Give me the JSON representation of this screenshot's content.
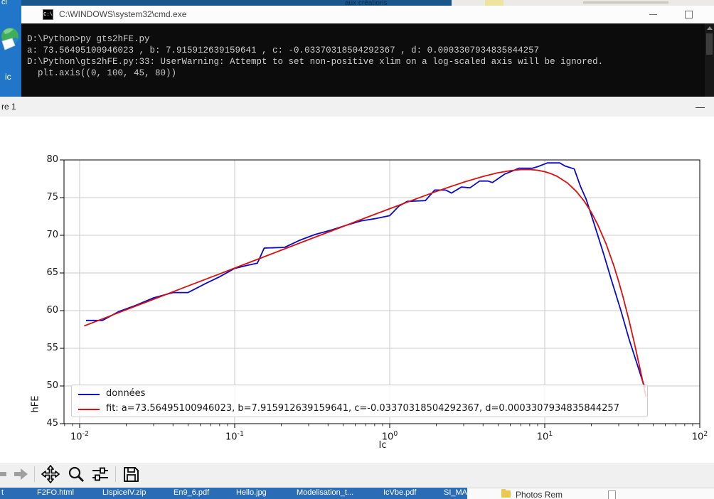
{
  "desktop": {
    "top_left_fragment": "cl",
    "left_icon_label": "ic",
    "top_strip_fragment": "aux créations",
    "right_panel_folder_label": "Photos Rem"
  },
  "cmd_window": {
    "title": "C:\\WINDOWS\\system32\\cmd.exe",
    "icon_text": "C:\\",
    "lines": [
      "D:\\Python>py gts2hFE.py",
      "a: 73.56495100946023 , b: 7.915912639159641 , c: -0.03370318504292367 , d: 0.0003307934835844257",
      "D:\\Python\\gts2hFE.py:33: UserWarning: Attempt to set non-positive xlim on a log-scaled axis will be ignored.",
      "  plt.axis((0, 100, 45, 80))"
    ]
  },
  "figure_window": {
    "title_fragment": "re 1"
  },
  "mpl_toolbar": {
    "icons": [
      "back",
      "forward",
      "pan",
      "zoom-to-rect",
      "configure-subplots",
      "save"
    ]
  },
  "taskbar": {
    "items": [
      "t",
      "F2FO.html",
      "LIspiceIV.zip",
      "En9_6.pdf",
      "Hello.jpg",
      "Modelisation_t...",
      "IcVbe.pdf",
      "SI_MAHI"
    ]
  },
  "chart_data": {
    "type": "line",
    "title": "",
    "xlabel": "Ic",
    "ylabel": "hFE",
    "x_scale": "log",
    "xlim": [
      0.0079,
      100
    ],
    "ylim": [
      45,
      80
    ],
    "y_ticks": [
      45,
      50,
      55,
      60,
      65,
      70,
      75,
      80
    ],
    "x_ticks": [
      {
        "mantissa": "10",
        "exponent": "-2",
        "value": 0.01
      },
      {
        "mantissa": "10",
        "exponent": "-1",
        "value": 0.1
      },
      {
        "mantissa": "10",
        "exponent": "0",
        "value": 1
      },
      {
        "mantissa": "10",
        "exponent": "1",
        "value": 10
      },
      {
        "mantissa": "10",
        "exponent": "2",
        "value": 100
      }
    ],
    "grid": true,
    "legend_position": "lower-left",
    "series": [
      {
        "name": "données",
        "color": "#0a0ac8",
        "x": [
          0.011,
          0.014,
          0.018,
          0.023,
          0.03,
          0.04,
          0.05,
          0.065,
          0.08,
          0.1,
          0.12,
          0.14,
          0.155,
          0.21,
          0.26,
          0.33,
          0.42,
          0.52,
          0.65,
          0.8,
          1.0,
          1.15,
          1.3,
          1.7,
          1.95,
          2.3,
          2.5,
          2.9,
          3.3,
          3.8,
          4.3,
          4.6,
          5.5,
          6.3,
          6.8,
          8.3,
          9.0,
          10.4,
          12.5,
          13.5,
          15.5,
          17.0,
          18.5,
          21.0,
          24.0,
          27.0,
          31.0,
          35.0,
          39.0,
          43.0,
          44.5
        ],
        "y": [
          58.7,
          58.7,
          59.9,
          60.7,
          61.7,
          62.4,
          62.4,
          63.6,
          64.5,
          65.6,
          66.0,
          66.3,
          68.3,
          68.4,
          69.3,
          70.1,
          70.7,
          71.3,
          71.9,
          72.2,
          72.6,
          73.9,
          74.5,
          74.6,
          76.0,
          76.0,
          75.6,
          76.4,
          76.3,
          77.2,
          77.2,
          77.0,
          78.1,
          78.6,
          78.9,
          78.9,
          79.1,
          79.6,
          79.6,
          79.2,
          78.8,
          76.5,
          74.8,
          71.3,
          67.5,
          64.0,
          60.0,
          56.2,
          53.2,
          50.5,
          49.8
        ]
      },
      {
        "name": "fit: a=73.56495100946023, b=7.915912639159641, c=-0.03370318504292367, d=0.0003307934835844257",
        "color": "#dc0f0f",
        "x": [
          0.0107,
          0.015,
          0.02,
          0.03,
          0.05,
          0.08,
          0.1,
          0.15,
          0.2,
          0.3,
          0.5,
          0.7,
          1.0,
          1.5,
          2.0,
          3.0,
          4.0,
          5.0,
          6.0,
          7.0,
          8.0,
          9.0,
          10.0,
          11.0,
          12.0,
          14.0,
          16.0,
          18.0,
          20.0,
          22.0,
          25.0,
          28.0,
          30.0,
          32.0,
          35.0,
          38.0,
          40.0,
          42.0,
          44.0,
          45.0
        ],
        "y": [
          57.97,
          59.13,
          60.12,
          61.51,
          63.27,
          64.88,
          65.65,
          67.04,
          68.03,
          69.42,
          71.17,
          72.32,
          73.53,
          74.88,
          75.82,
          77.05,
          77.81,
          78.3,
          78.58,
          78.72,
          78.73,
          78.63,
          78.44,
          78.17,
          77.83,
          76.94,
          75.82,
          74.51,
          73.03,
          71.4,
          68.73,
          65.86,
          63.86,
          61.81,
          58.68,
          55.55,
          53.48,
          51.46,
          49.5,
          48.54
        ]
      }
    ]
  }
}
